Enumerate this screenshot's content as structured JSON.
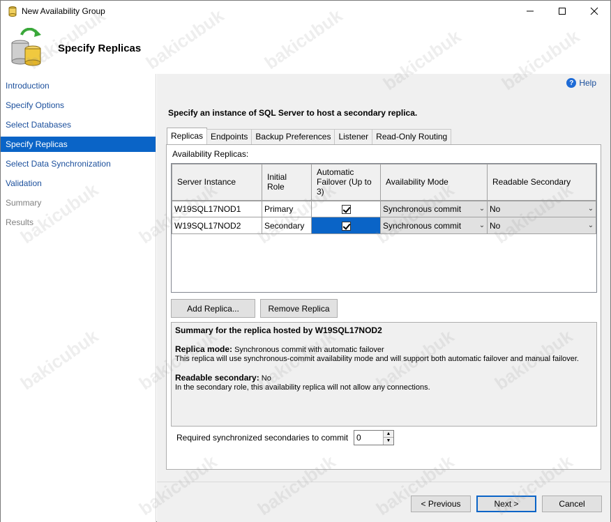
{
  "window": {
    "title": "New Availability Group"
  },
  "header": {
    "heading": "Specify Replicas"
  },
  "nav": {
    "items": [
      {
        "label": "Introduction",
        "state": "link"
      },
      {
        "label": "Specify Options",
        "state": "link"
      },
      {
        "label": "Select Databases",
        "state": "link"
      },
      {
        "label": "Specify Replicas",
        "state": "active"
      },
      {
        "label": "Select Data Synchronization",
        "state": "link"
      },
      {
        "label": "Validation",
        "state": "link"
      },
      {
        "label": "Summary",
        "state": "disabled"
      },
      {
        "label": "Results",
        "state": "disabled"
      }
    ]
  },
  "help": {
    "label": "Help"
  },
  "instruction": "Specify an instance of SQL Server to host a secondary replica.",
  "tabs": [
    "Replicas",
    "Endpoints",
    "Backup Preferences",
    "Listener",
    "Read-Only Routing"
  ],
  "replicas": {
    "label": "Availability Replicas:",
    "columns": {
      "server": "Server Instance",
      "role": "Initial Role",
      "failover": "Automatic Failover (Up to 3)",
      "mode": "Availability Mode",
      "readable": "Readable Secondary"
    },
    "rows": [
      {
        "server": "W19SQL17NOD1",
        "role": "Primary",
        "failover": true,
        "mode": "Synchronous commit",
        "readable": "No"
      },
      {
        "server": "W19SQL17NOD2",
        "role": "Secondary",
        "failover": true,
        "mode": "Synchronous commit",
        "readable": "No"
      }
    ]
  },
  "buttons": {
    "add_replica": "Add Replica...",
    "remove_replica": "Remove Replica",
    "previous": "< Previous",
    "next": "Next >",
    "cancel": "Cancel"
  },
  "summary": {
    "title": "Summary for the replica hosted by W19SQL17NOD2",
    "mode_label": "Replica mode:",
    "mode_value": " Synchronous commit with automatic failover",
    "mode_desc": "This replica will use synchronous-commit availability mode and will support both automatic failover and manual failover.",
    "readable_label": "Readable secondary:",
    "readable_value": " No",
    "readable_desc": "In the secondary role, this availability replica will not allow any connections."
  },
  "required_sync": {
    "label": "Required synchronized secondaries to commit",
    "value": "0"
  },
  "watermark": "bakicubuk",
  "colors": {
    "accent": "#0a64c7",
    "link": "#1b4f9c"
  }
}
